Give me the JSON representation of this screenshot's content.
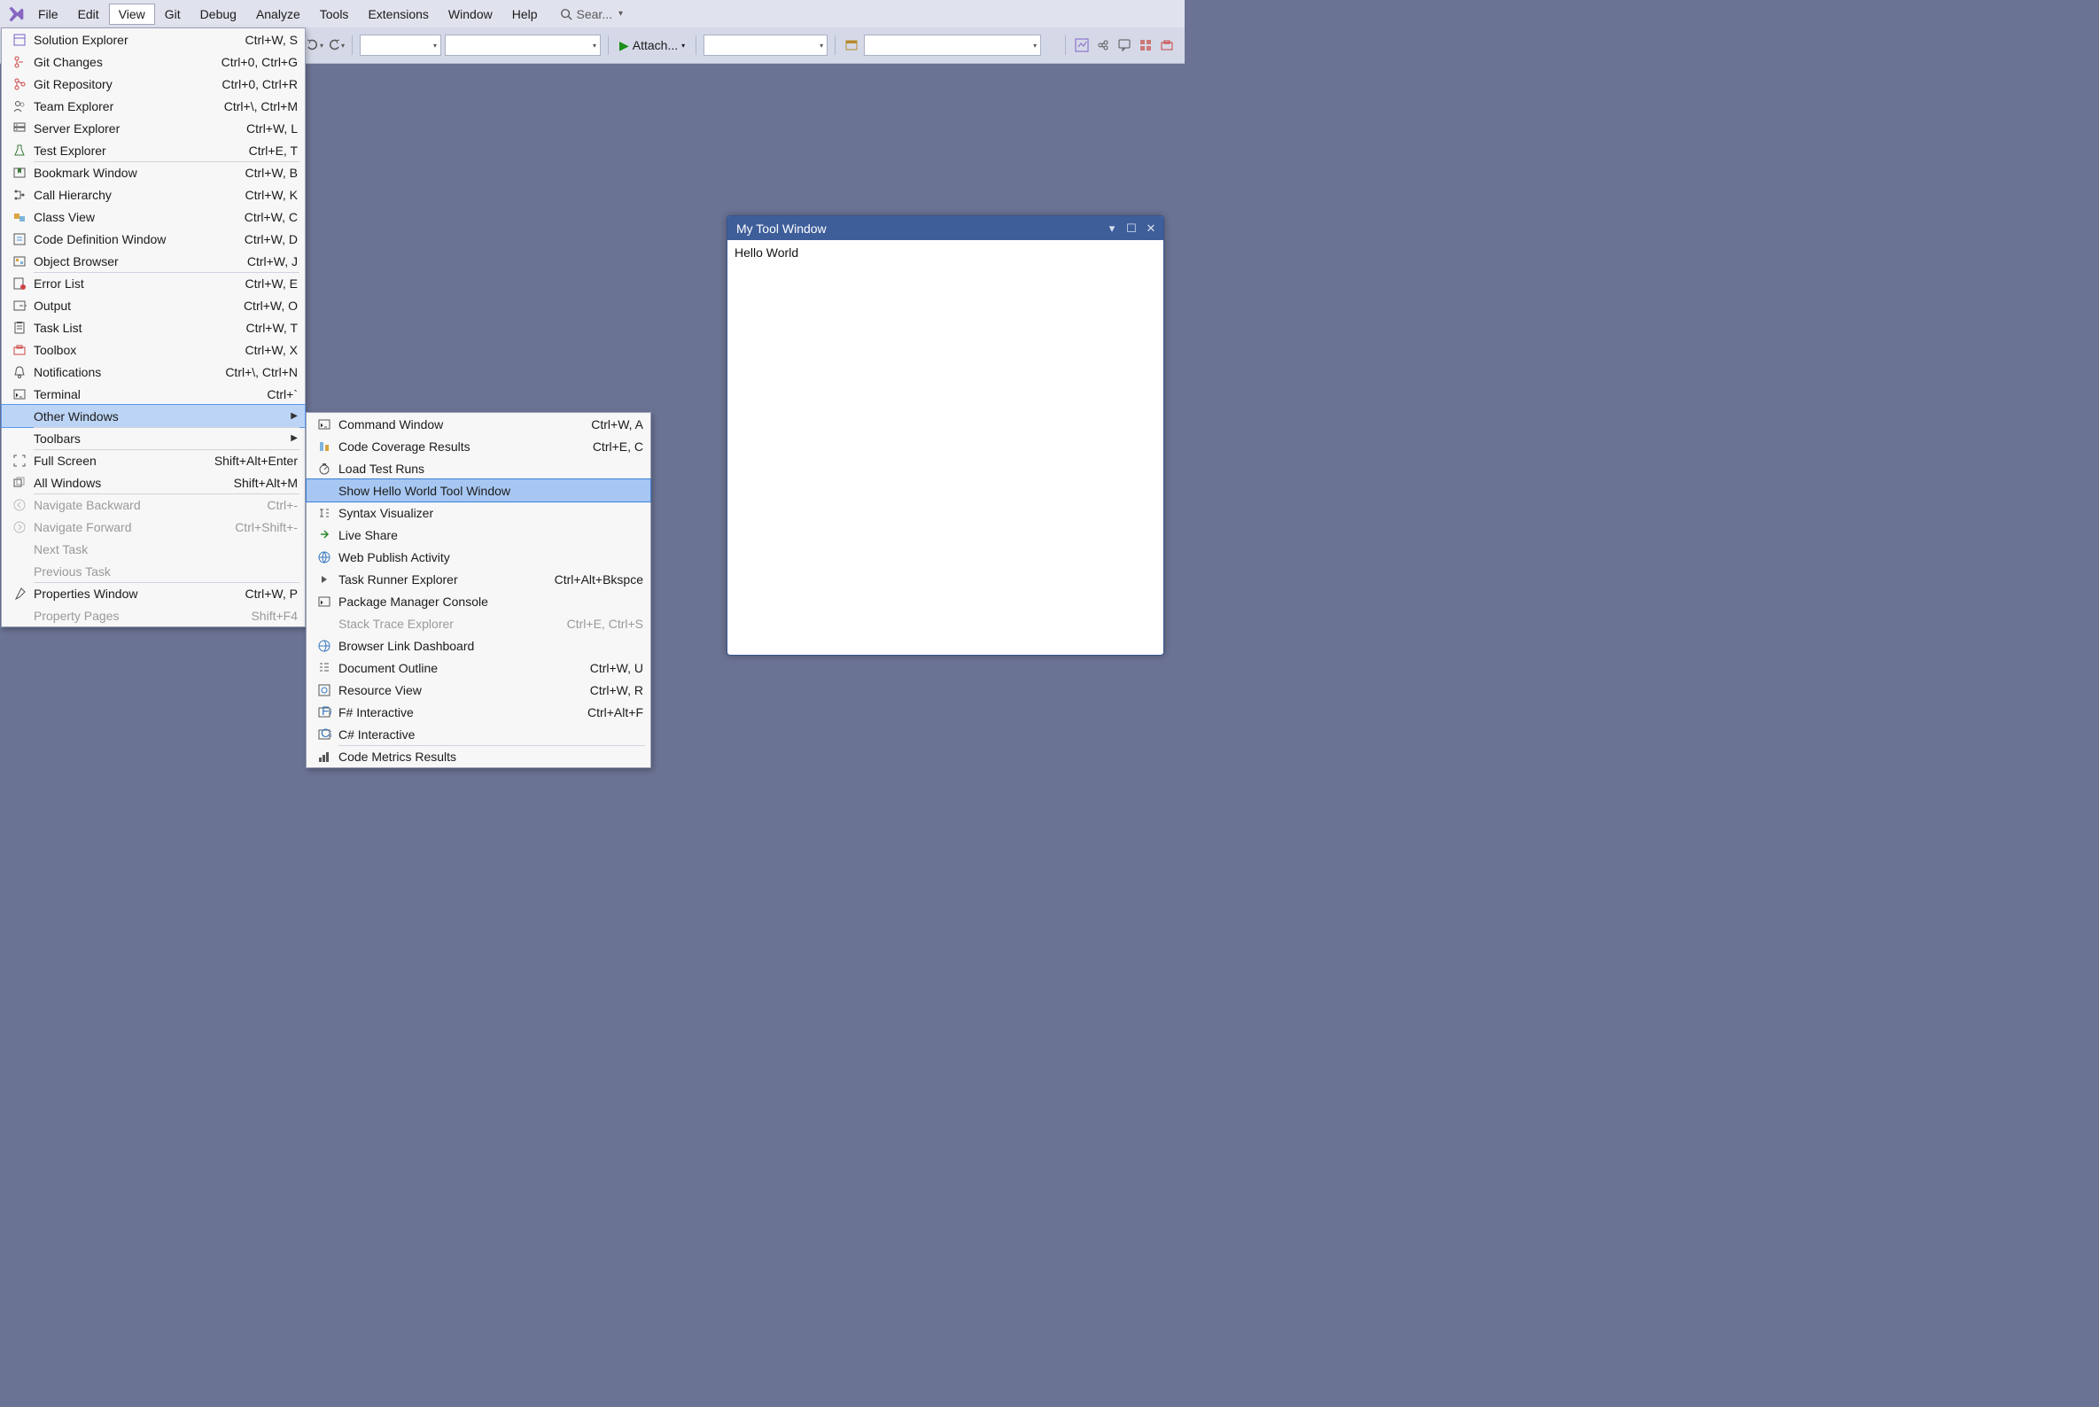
{
  "menubar": {
    "items": [
      "File",
      "Edit",
      "View",
      "Git",
      "Debug",
      "Analyze",
      "Tools",
      "Extensions",
      "Window",
      "Help"
    ],
    "active_index": 2,
    "search_placeholder": "Sear..."
  },
  "toolbar": {
    "attach_label": "Attach..."
  },
  "view_menu": [
    {
      "icon": "solution-explorer-icon",
      "label": "Solution Explorer",
      "shortcut": "Ctrl+W, S"
    },
    {
      "icon": "git-changes-icon",
      "label": "Git Changes",
      "shortcut": "Ctrl+0, Ctrl+G"
    },
    {
      "icon": "git-repository-icon",
      "label": "Git Repository",
      "shortcut": "Ctrl+0, Ctrl+R"
    },
    {
      "icon": "team-explorer-icon",
      "label": "Team Explorer",
      "shortcut": "Ctrl+\\, Ctrl+M"
    },
    {
      "icon": "server-explorer-icon",
      "label": "Server Explorer",
      "shortcut": "Ctrl+W, L"
    },
    {
      "icon": "test-explorer-icon",
      "label": "Test Explorer",
      "shortcut": "Ctrl+E, T",
      "sep": true
    },
    {
      "icon": "bookmark-window-icon",
      "label": "Bookmark Window",
      "shortcut": "Ctrl+W, B"
    },
    {
      "icon": "call-hierarchy-icon",
      "label": "Call Hierarchy",
      "shortcut": "Ctrl+W, K"
    },
    {
      "icon": "class-view-icon",
      "label": "Class View",
      "shortcut": "Ctrl+W, C"
    },
    {
      "icon": "code-definition-icon",
      "label": "Code Definition Window",
      "shortcut": "Ctrl+W, D"
    },
    {
      "icon": "object-browser-icon",
      "label": "Object Browser",
      "shortcut": "Ctrl+W, J",
      "sep": true
    },
    {
      "icon": "error-list-icon",
      "label": "Error List",
      "shortcut": "Ctrl+W, E"
    },
    {
      "icon": "output-icon",
      "label": "Output",
      "shortcut": "Ctrl+W, O"
    },
    {
      "icon": "task-list-icon",
      "label": "Task List",
      "shortcut": "Ctrl+W, T"
    },
    {
      "icon": "toolbox-icon",
      "label": "Toolbox",
      "shortcut": "Ctrl+W, X"
    },
    {
      "icon": "notifications-icon",
      "label": "Notifications",
      "shortcut": "Ctrl+\\, Ctrl+N"
    },
    {
      "icon": "terminal-icon",
      "label": "Terminal",
      "shortcut": "Ctrl+`",
      "sep": true
    },
    {
      "icon": "",
      "label": "Other Windows",
      "submenu": true,
      "highlighted": true,
      "sep": true
    },
    {
      "icon": "",
      "label": "Toolbars",
      "submenu": true,
      "sep": true
    },
    {
      "icon": "fullscreen-icon",
      "label": "Full Screen",
      "shortcut": "Shift+Alt+Enter"
    },
    {
      "icon": "all-windows-icon",
      "label": "All Windows",
      "shortcut": "Shift+Alt+M",
      "sep": true
    },
    {
      "icon": "navigate-backward-icon",
      "label": "Navigate Backward",
      "shortcut": "Ctrl+-",
      "disabled": true
    },
    {
      "icon": "navigate-forward-icon",
      "label": "Navigate Forward",
      "shortcut": "Ctrl+Shift+-",
      "disabled": true
    },
    {
      "icon": "",
      "label": "Next Task",
      "disabled": true
    },
    {
      "icon": "",
      "label": "Previous Task",
      "disabled": true,
      "sep": true
    },
    {
      "icon": "properties-window-icon",
      "label": "Properties Window",
      "shortcut": "Ctrl+W, P"
    },
    {
      "icon": "",
      "label": "Property Pages",
      "shortcut": "Shift+F4",
      "disabled": true
    }
  ],
  "sub_menu": [
    {
      "icon": "command-window-icon",
      "label": "Command Window",
      "shortcut": "Ctrl+W, A"
    },
    {
      "icon": "code-coverage-icon",
      "label": "Code Coverage Results",
      "shortcut": "Ctrl+E, C"
    },
    {
      "icon": "load-test-icon",
      "label": "Load Test Runs"
    },
    {
      "icon": "",
      "label": "Show Hello World Tool Window",
      "selected": true
    },
    {
      "icon": "syntax-visualizer-icon",
      "label": "Syntax Visualizer"
    },
    {
      "icon": "live-share-icon",
      "label": "Live Share"
    },
    {
      "icon": "web-publish-icon",
      "label": "Web Publish Activity"
    },
    {
      "icon": "task-runner-icon",
      "label": "Task Runner Explorer",
      "shortcut": "Ctrl+Alt+Bkspce"
    },
    {
      "icon": "package-manager-icon",
      "label": "Package Manager Console"
    },
    {
      "icon": "",
      "label": "Stack Trace Explorer",
      "shortcut": "Ctrl+E, Ctrl+S",
      "disabled": true
    },
    {
      "icon": "browser-link-icon",
      "label": "Browser Link Dashboard"
    },
    {
      "icon": "document-outline-icon",
      "label": "Document Outline",
      "shortcut": "Ctrl+W, U"
    },
    {
      "icon": "resource-view-icon",
      "label": "Resource View",
      "shortcut": "Ctrl+W, R"
    },
    {
      "icon": "fsharp-icon",
      "label": "F# Interactive",
      "shortcut": "Ctrl+Alt+F"
    },
    {
      "icon": "csharp-icon",
      "label": "C# Interactive",
      "sep": true
    },
    {
      "icon": "code-metrics-icon",
      "label": "Code Metrics Results"
    }
  ],
  "tool_window": {
    "title": "My Tool Window",
    "content": "Hello World"
  }
}
